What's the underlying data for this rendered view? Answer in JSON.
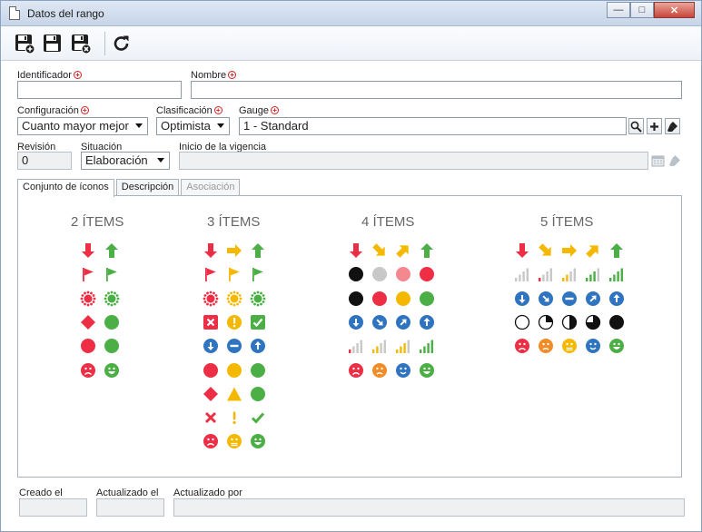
{
  "window": {
    "title": "Datos del rango",
    "buttons": [
      "minimize",
      "maximize",
      "close"
    ]
  },
  "toolbar": {
    "buttons": [
      {
        "name": "save-new-button",
        "icon": "save-plus-icon"
      },
      {
        "name": "save-button",
        "icon": "save-icon"
      },
      {
        "name": "save-close-button",
        "icon": "save-close-icon"
      },
      {
        "name": "refresh-button",
        "icon": "refresh-icon"
      }
    ]
  },
  "fields": {
    "identificador": {
      "label": "Identificador",
      "value": ""
    },
    "nombre": {
      "label": "Nombre",
      "value": ""
    },
    "configuracion": {
      "label": "Configuración",
      "value": "Cuanto mayor mejor"
    },
    "clasificacion": {
      "label": "Clasificación",
      "value": "Optimista"
    },
    "gauge": {
      "label": "Gauge",
      "value": "1 - Standard"
    },
    "revision": {
      "label": "Revisión",
      "value": "0"
    },
    "situacion": {
      "label": "Situación",
      "value": "Elaboración"
    },
    "inicio": {
      "label": "Inicio de la vigencia",
      "value": ""
    }
  },
  "tabs": [
    {
      "label": "Conjunto de íconos",
      "state": "active"
    },
    {
      "label": "Descripción",
      "state": "normal"
    },
    {
      "label": "Asociación",
      "state": "disabled"
    }
  ],
  "icon_sets": [
    {
      "title": "2 ÍTEMS",
      "rows": [
        [
          "arrow-down-red",
          "arrow-up-green"
        ],
        [
          "flag-red",
          "flag-green"
        ],
        [
          "burst-red",
          "burst-green"
        ],
        [
          "diamond-red",
          "circle-green"
        ],
        [
          "circle-red",
          "circle-green"
        ],
        [
          "face-sad-red",
          "face-happy-green"
        ]
      ]
    },
    {
      "title": "3 ÍTEMS",
      "rows": [
        [
          "arrow-down-red",
          "arrow-right-yellow",
          "arrow-up-green"
        ],
        [
          "flag-red",
          "flag-yellow",
          "flag-green"
        ],
        [
          "burst-red",
          "burst-yellow",
          "burst-green"
        ],
        [
          "box-x-red",
          "exclaim-circle-yellow",
          "box-check-green"
        ],
        [
          "badge-down-blue",
          "badge-minus-blue",
          "badge-up-blue"
        ],
        [
          "circle-red",
          "circle-yellow",
          "circle-green"
        ],
        [
          "diamond-red",
          "triangle-yellow",
          "circle-green"
        ],
        [
          "x-red",
          "exclaim-yellow",
          "check-green"
        ],
        [
          "face-sad-red",
          "face-neutral-yellow",
          "face-happy-green"
        ]
      ]
    },
    {
      "title": "4 ÍTEMS",
      "rows": [
        [
          "arrow-down-red",
          "arrow-downright-yellow",
          "arrow-upright-yellow",
          "arrow-up-green"
        ],
        [
          "circle-black",
          "circle-gray",
          "circle-pink",
          "circle-red"
        ],
        [
          "circle-black",
          "circle-red",
          "circle-yellow",
          "circle-green"
        ],
        [
          "badge-down-blue",
          "badge-downright-blue",
          "badge-upright-blue",
          "badge-up-blue"
        ],
        [
          "bars1-red",
          "bars2-yellow",
          "bars3-yellow",
          "bars4-green"
        ],
        [
          "face-sad-red",
          "face-frown-orange",
          "face-smile-blue",
          "face-happy-green"
        ]
      ]
    },
    {
      "title": "5 ÍTEMS",
      "rows": [
        [
          "arrow-down-red",
          "arrow-downright-yellow",
          "arrow-right-yellow",
          "arrow-upright-yellow",
          "arrow-up-green"
        ],
        [
          "bars0-gray",
          "bars1-red",
          "bars2-yellow",
          "bars3-green",
          "bars4-green"
        ],
        [
          "badge-down-blue",
          "badge-downright-blue",
          "badge-minus-blue",
          "badge-upright-blue",
          "badge-up-blue"
        ],
        [
          "pie0-black",
          "pie1-black",
          "pie2-black",
          "pie3-black",
          "pie4-black"
        ],
        [
          "face-sad-red",
          "face-frown-orange",
          "face-neutral-yellow",
          "face-smile-blue",
          "face-happy-green"
        ]
      ]
    }
  ],
  "footer": {
    "creado": {
      "label": "Creado el",
      "value": ""
    },
    "actualizado": {
      "label": "Actualizado el",
      "value": ""
    },
    "actualizado_por": {
      "label": "Actualizado por",
      "value": ""
    }
  },
  "colors": {
    "red": "#ee2e45",
    "green": "#4caf45",
    "yellow": "#f5b800",
    "blue": "#2e74c0",
    "orange": "#f28c28",
    "gray": "#c8c8c8",
    "pink": "#f5878f",
    "black": "#111111"
  }
}
